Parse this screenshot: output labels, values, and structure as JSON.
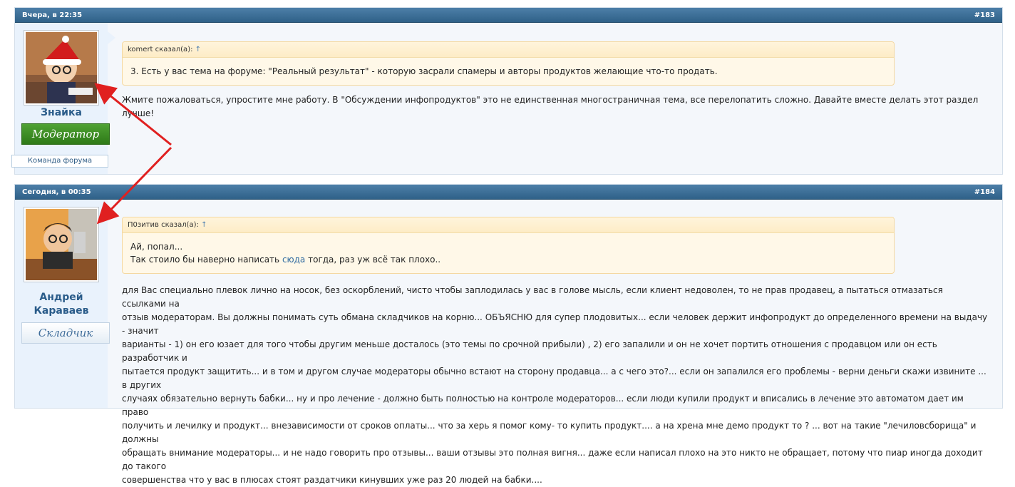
{
  "posts": [
    {
      "date": "Вчера, в 22:35",
      "number": "#183",
      "author": {
        "name": "Знайка",
        "role": "Модератор",
        "team": "Команда форума"
      },
      "quote": {
        "header": "komert сказал(а):",
        "up": "↑",
        "line1": "3. Есть у вас тема на форуме: \"Реальный результат\" - которую засрали спамеры и авторы продуктов желающие что-то продать."
      },
      "message": "Жмите пожаловаться, упростите мне работу. В \"Обсуждении инфопродуктов\" это не единственная многостраничная тема, все перелопатить сложно. Давайте вместе делать этот раздел лучше!"
    },
    {
      "date": "Сегодня, в 00:35",
      "number": "#184",
      "author": {
        "name_line1": "Андрей",
        "name_line2": "Караваев",
        "role": "Складчик"
      },
      "quote": {
        "header": "П0зитив сказал(а):",
        "up": "↑",
        "line1": "Ай, попал...",
        "line2_before": "Так стоило бы наверно написать ",
        "line2_link": "сюда",
        "line2_after": " тогда, раз уж всё так плохо.."
      },
      "message_lines": [
        "для Вас специально плевок лично на носок, без оскорблений, чисто чтобы заплодилась у вас в голове мысль, если клиент недоволен, то не прав продавец, а пытаться отмазаться ссылками на",
        "отзыв модераторам. Вы должны понимать суть обмана складчиков на корню... ОБЪЯСНЮ для супер плодовитых... если человек держит инфопродукт до определенного времени на выдачу - значит",
        "варианты - 1) он его юзает для того чтобы другим меньше досталось (это темы по срочной прибыли) , 2) его запалили и он не хочет портить отношения с продавцом или он есть разработчик и",
        "пытается продукт защитить... и в том и другом случае модераторы обычно встают на сторону продавца... а с чего это?... если он запалился его проблемы - верни деньги скажи извините ... в других",
        "случаях обязательно вернуть бабки... ну и про лечение - должно быть полностью на контроле модераторов... если люди купили продукт и вписались в лечение это автоматом дает им право",
        "получить и лечилку и продукт... внезависимости от сроков оплаты... что за херь я помог кому- то купить продукт.... а на хрена мне демо продукт то ? ... вот на такие \"лечиловсборища\" и должны",
        "обращать внимание модераторы... и не надо говорить про отзывы... ваши отзывы это полная вигня... даже если написал плохо на это никто не обращает, потому что пиар иногда доходит до такого",
        "совершенства что у вас в плюсах стоят раздатчики кинувших уже раз 20 людей на бабки...."
      ]
    }
  ],
  "colors": {
    "header": "#2f6188",
    "arrow": "#e02020",
    "link": "#2f6aa0"
  }
}
